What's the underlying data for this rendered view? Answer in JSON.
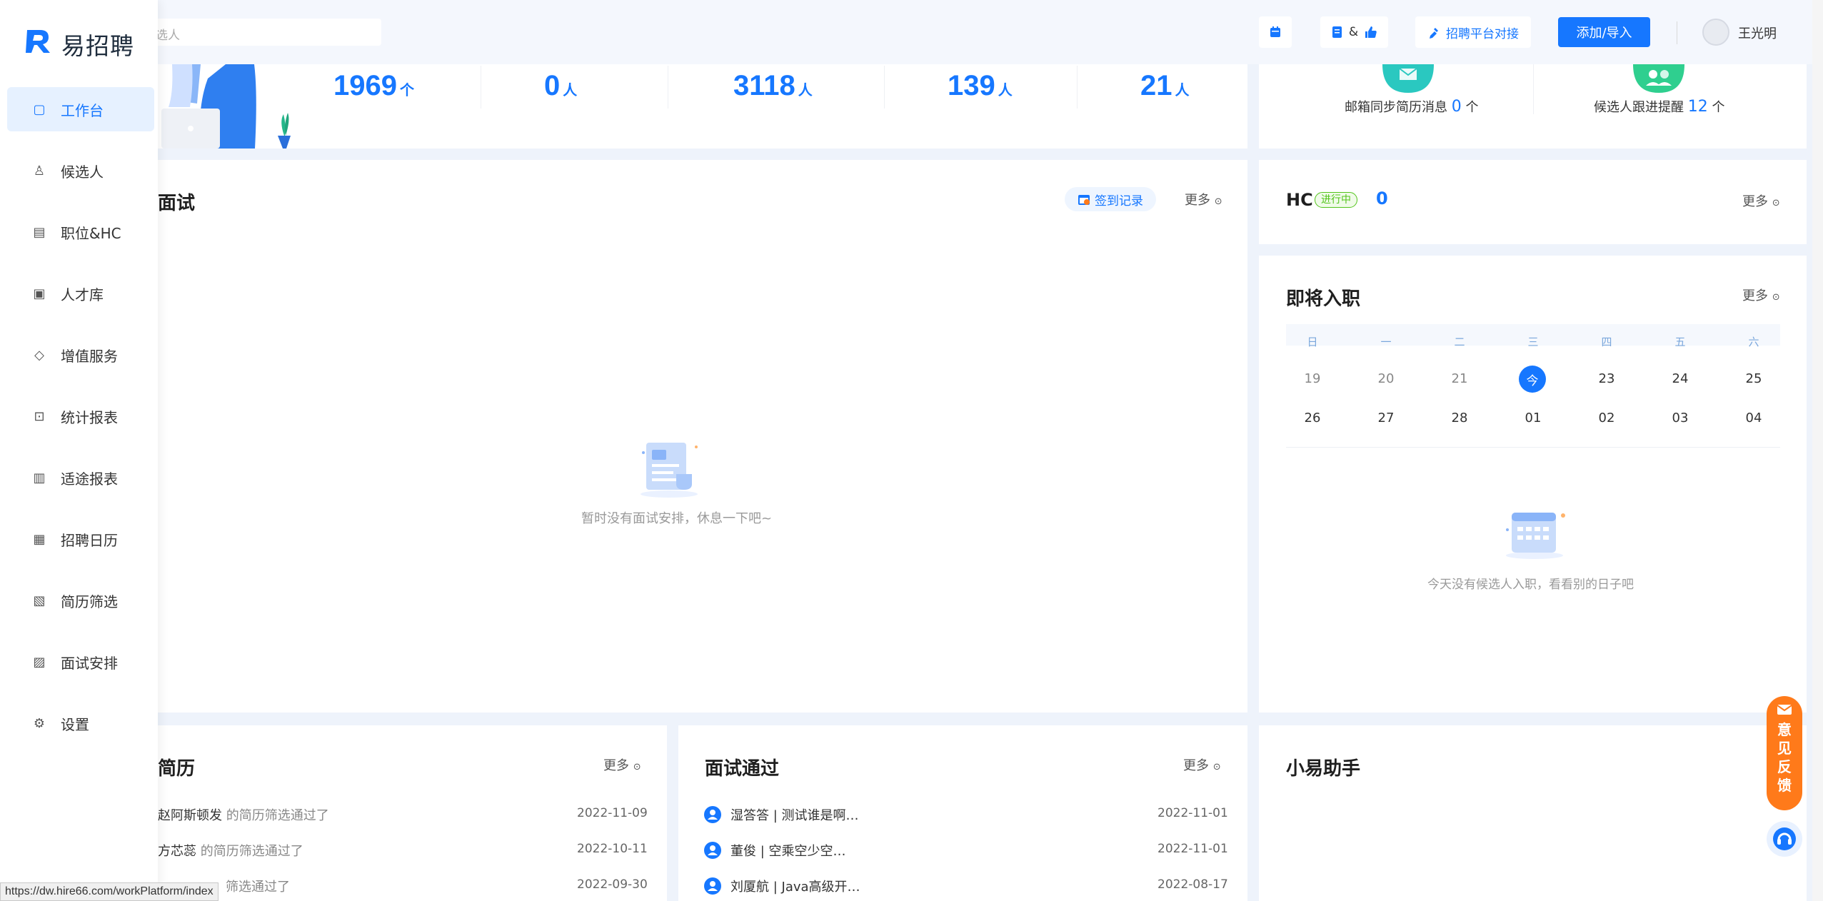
{
  "header": {
    "search_placeholder": "选人",
    "btn_calendar_icon": "calendar-icon",
    "btn_mixed_amp": "&",
    "btn_platform_label": "招聘平台对接",
    "btn_add_label": "添加/导入",
    "user_name": "王光明"
  },
  "sidebar": {
    "logo_text": "易招聘",
    "items": [
      {
        "label": "工作台",
        "icon": "workbench-icon",
        "active": true
      },
      {
        "label": "候选人",
        "icon": "person-icon"
      },
      {
        "label": "职位&HC",
        "icon": "job-icon"
      },
      {
        "label": "人才库",
        "icon": "talent-icon"
      },
      {
        "label": "增值服务",
        "icon": "diamond-icon"
      },
      {
        "label": "统计报表",
        "icon": "chart-icon"
      },
      {
        "label": "适途报表",
        "icon": "bar-chart-icon"
      },
      {
        "label": "招聘日历",
        "icon": "calendar-icon"
      },
      {
        "label": "简历筛选",
        "icon": "resume-icon"
      },
      {
        "label": "面试安排",
        "icon": "schedule-icon"
      },
      {
        "label": "设置",
        "icon": "settings-icon"
      }
    ]
  },
  "stats": [
    {
      "value": "1969",
      "unit": "个"
    },
    {
      "value": "0",
      "unit": "人"
    },
    {
      "value": "3118",
      "unit": "人"
    },
    {
      "value": "139",
      "unit": "人"
    },
    {
      "value": "21",
      "unit": "人"
    }
  ],
  "notices": {
    "mail_label": "邮箱同步简历消息",
    "mail_count": "0",
    "mail_unit": "个",
    "follow_label": "候选人跟进提醒",
    "follow_count": "12",
    "follow_unit": "个"
  },
  "interview_card": {
    "title": "面试",
    "signin_label": "签到记录",
    "more": "更多",
    "empty": "暂时没有面试安排，休息一下吧~"
  },
  "hc_card": {
    "title": "HC",
    "badge": "进行中",
    "count": "0",
    "more": "更多"
  },
  "onboard_card": {
    "title": "即将入职",
    "more": "更多",
    "weekdays": [
      "日",
      "一",
      "二",
      "三",
      "四",
      "五",
      "六"
    ],
    "week1": [
      "19",
      "20",
      "21",
      "今",
      "23",
      "24",
      "25"
    ],
    "week2": [
      "26",
      "27",
      "28",
      "01",
      "02",
      "03",
      "04"
    ],
    "empty": "今天没有候选人入职，看看别的日子吧"
  },
  "resume_card": {
    "title": "简历",
    "more": "更多",
    "rows": [
      {
        "name": "赵阿斯顿发",
        "text": "的简历筛选通过了",
        "date": "2022-11-09"
      },
      {
        "name": "方芯蕊",
        "text": "的简历筛选通过了",
        "date": "2022-10-11"
      },
      {
        "name": "",
        "text": "筛选通过了",
        "date": "2022-09-30"
      }
    ]
  },
  "passed_card": {
    "title": "面试通过",
    "more": "更多",
    "rows": [
      {
        "name": "湿答答",
        "text": "| 测试谁是啊…",
        "date": "2022-11-01"
      },
      {
        "name": "董俊",
        "text": "| 空乘空少空…",
        "date": "2022-11-01"
      },
      {
        "name": "刘厦航",
        "text": "| Java高级开…",
        "date": "2022-08-17"
      }
    ]
  },
  "assistant_card": {
    "title": "小易助手"
  },
  "feedback": {
    "label_chars": [
      "意",
      "见",
      "反",
      "馈"
    ]
  },
  "status_bar": {
    "url": "https://dw.hire66.com/workPlatform/index"
  },
  "colors": {
    "accent": "#1677ff",
    "feedback": "#ff7a1a",
    "hc_badge": "#52c41a"
  }
}
